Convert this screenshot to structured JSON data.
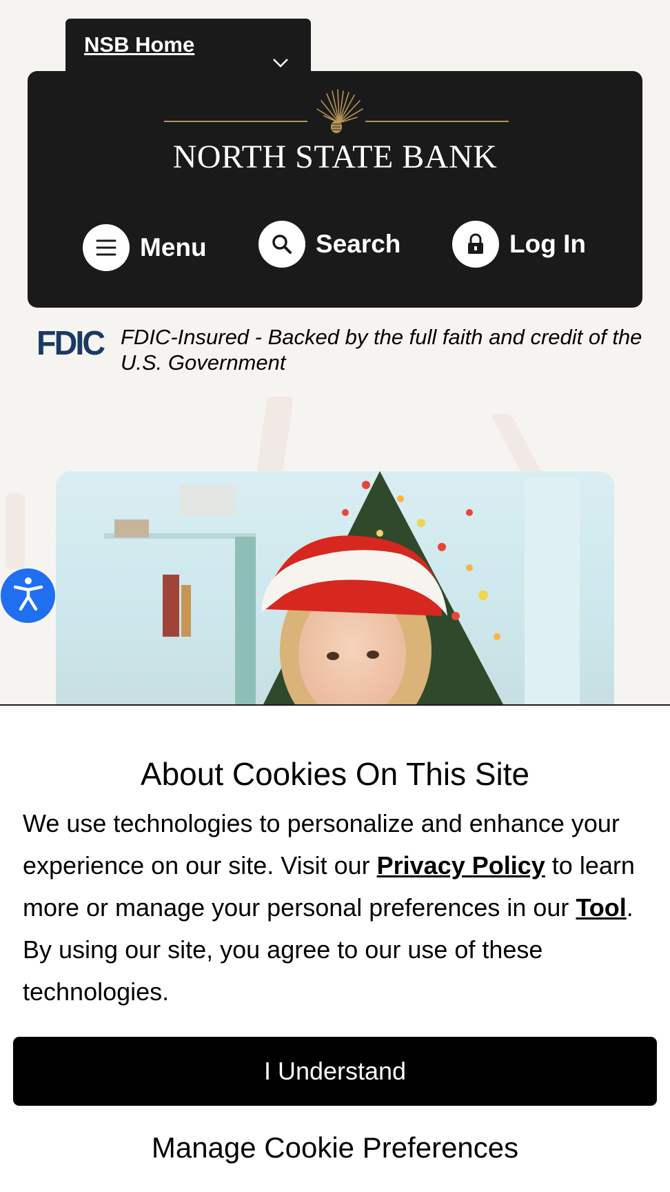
{
  "home_tab": {
    "label": "NSB Home"
  },
  "header": {
    "bank_name": "NORTH STATE BANK",
    "nav": {
      "menu_label": "Menu",
      "search_label": "Search",
      "login_label": "Log In"
    }
  },
  "fdic": {
    "logo_text": "FDIC",
    "text": "FDIC-Insured - Backed by the full faith and credit of the U.S. Government"
  },
  "cookie_banner": {
    "title": "About Cookies On This Site",
    "body_part1": "We use technologies to personalize and enhance your experience on our site. Visit our ",
    "privacy_link": "Privacy Policy",
    "body_part2": " to learn more or manage your personal preferences in our ",
    "tool_link": "Tool",
    "body_part3": ". By using our site, you agree to our use of these technologies.",
    "understand_button": "I Understand",
    "manage_link": "Manage Cookie Preferences"
  },
  "colors": {
    "header_bg": "#1b1a1a",
    "page_bg": "#f6f4f1",
    "fdic_blue": "#1b3a63",
    "gold_accent": "#b89658",
    "accessibility_blue": "#1f6ff0"
  },
  "icons": {
    "home_tab": "chevron-down-icon",
    "menu": "hamburger-icon",
    "search": "search-icon",
    "login": "lock-icon",
    "accessibility": "accessibility-person-icon",
    "logo": "pinecone-logo-icon"
  }
}
